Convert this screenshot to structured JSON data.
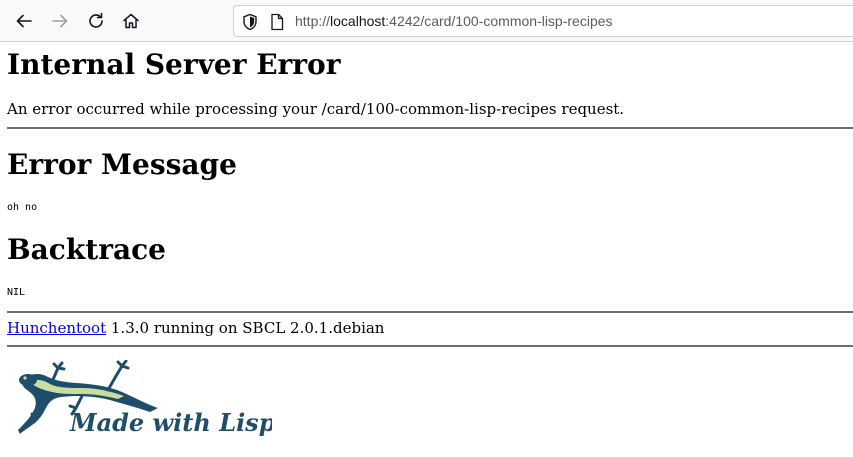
{
  "browser": {
    "url_prefix": "http://",
    "url_host": "localhost",
    "url_rest": ":4242/card/100-common-lisp-recipes"
  },
  "page": {
    "title": "Internal Server Error",
    "intro": "An error occurred while processing your /card/100-common-lisp-recipes request.",
    "error_heading": "Error Message",
    "error_text": "oh no",
    "backtrace_heading": "Backtrace",
    "backtrace_text": "NIL",
    "footer_link": "Hunchentoot",
    "footer_rest": " 1.3.0 running on SBCL 2.0.1.debian",
    "logo_text": "Made with Lisp"
  },
  "colors": {
    "link": "#0000ee",
    "logo_blue": "#1f4e6b",
    "logo_green": "#c9dca2"
  }
}
